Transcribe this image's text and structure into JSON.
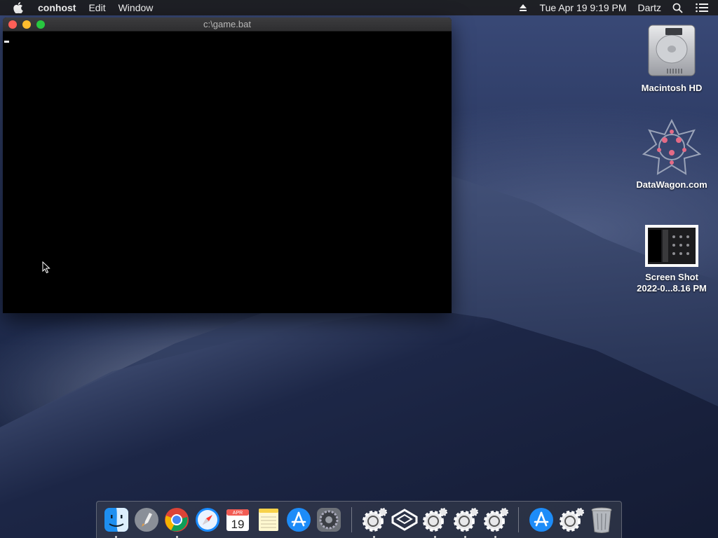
{
  "menubar": {
    "app_name": "conhost",
    "items": [
      "Edit",
      "Window"
    ],
    "datetime": "Tue Apr 19  9:19 PM",
    "user": "Dartz"
  },
  "window": {
    "title": "c:\\game.bat"
  },
  "desktop": {
    "icons": [
      {
        "label": "Macintosh HD"
      },
      {
        "label": "DataWagon.com"
      },
      {
        "label_line1": "Screen Shot",
        "label_line2": "2022-0...8.16 PM"
      }
    ]
  },
  "dock": {
    "calendar_month": "APR",
    "calendar_day": "19",
    "items": [
      "finder-icon",
      "launchpad-icon",
      "chrome-icon",
      "safari-icon",
      "calendar-icon",
      "notes-icon",
      "app-store-icon",
      "system-preferences-icon",
      "gear-app-icon",
      "cube-app-icon",
      "gear-app-icon",
      "gear-app-icon",
      "gear-app-icon",
      "app-store-icon",
      "gear-app-icon",
      "trash-icon"
    ]
  }
}
